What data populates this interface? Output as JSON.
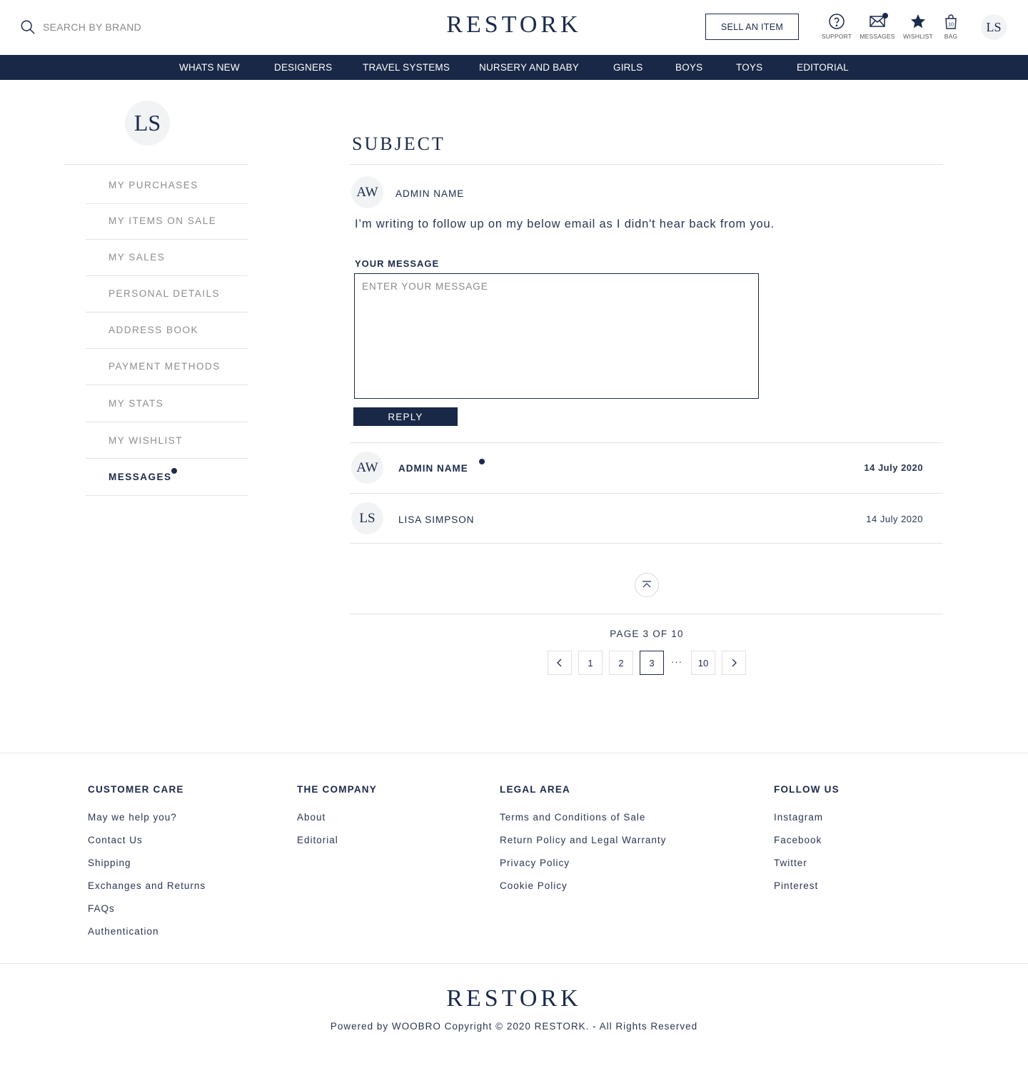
{
  "header": {
    "search_placeholder": "SEARCH BY BRAND",
    "logo": "RESTORK",
    "sell_button": "SELL AN ITEM",
    "icons": {
      "support": "SUPPORT",
      "messages": "MESSAGES",
      "wishlist": "WISHLIST",
      "bag": "BAG",
      "bag_count": "10"
    },
    "user_initials": "LS"
  },
  "nav": [
    "WHATS NEW",
    "DESIGNERS",
    "TRAVEL SYSTEMS",
    "NURSERY AND BABY",
    "GIRLS",
    "BOYS",
    "TOYS",
    "EDITORIAL"
  ],
  "sidebar": {
    "initials": "LS",
    "items": [
      "MY PURCHASES",
      "MY ITEMS ON SALE",
      "MY SALES",
      "PERSONAL DETAILS",
      "ADDRESS BOOK",
      "PAYMENT METHODS",
      "MY STATS",
      "MY WISHLIST",
      "MESSAGES"
    ]
  },
  "conversation": {
    "subject": "SUBJECT",
    "latest": {
      "initials": "AW",
      "name": "ADMIN NAME",
      "body": "I’m writing to follow up on my below email as I didn't hear back from you."
    },
    "your_message_label": "YOUR MESSAGE",
    "message_placeholder": "ENTER YOUR MESSAGE",
    "reply_button": "REPLY",
    "threads": [
      {
        "initials": "AW",
        "name": "ADMIN NAME",
        "date": "14 July 2020"
      },
      {
        "initials": "LS",
        "name": "LISA SIMPSON",
        "date": "14 July 2020"
      }
    ]
  },
  "pagination": {
    "label": "PAGE 3 OF 10",
    "pages": [
      "1",
      "2",
      "3",
      "10"
    ],
    "ellipsis": "···"
  },
  "footer": {
    "customer_care": {
      "title": "CUSTOMER CARE",
      "links": [
        "May we help you?",
        "Contact Us",
        "Shipping",
        "Exchanges and Returns",
        "FAQs",
        "Authentication"
      ]
    },
    "company": {
      "title": "THE COMPANY",
      "links": [
        "About",
        "Editorial"
      ]
    },
    "legal": {
      "title": "LEGAL AREA",
      "links": [
        "Terms and Conditions of Sale",
        "Return Policy and Legal Warranty",
        "Privacy Policy",
        "Cookie Policy"
      ]
    },
    "follow": {
      "title": "FOLLOW US",
      "links": [
        "Instagram",
        "Facebook",
        "Twitter",
        "Pinterest"
      ]
    },
    "logo": "RESTORK",
    "copyright": "Powered by WOOBRO Copyright © 2020 RESTORK. - All Rights Reserved"
  },
  "colors": {
    "brand": "#192846",
    "divider": "#e3e3e3",
    "muted": "#8d8d8d"
  }
}
